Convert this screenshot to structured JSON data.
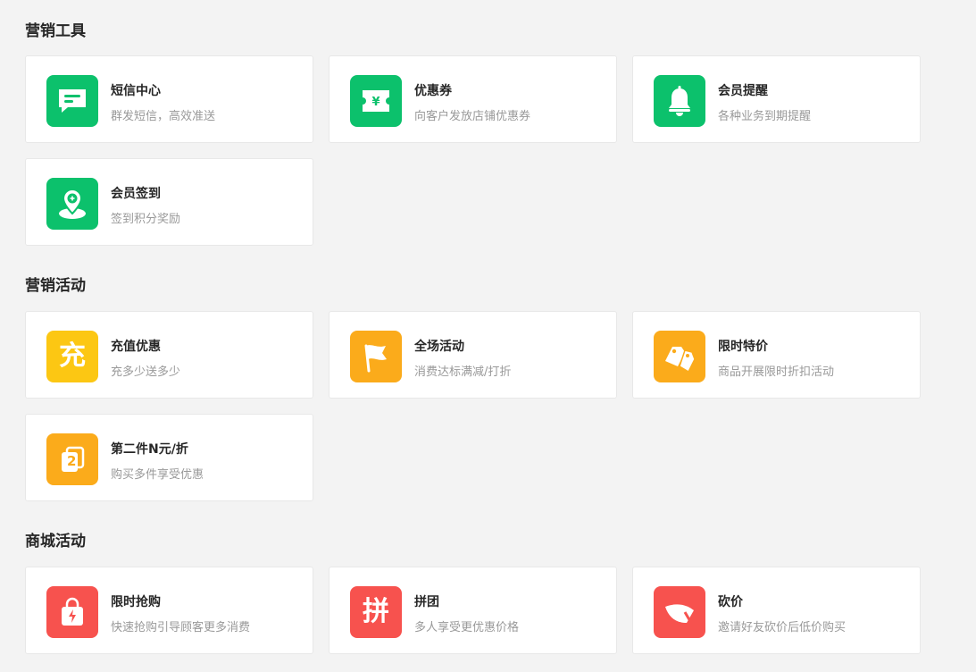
{
  "colors": {
    "green": "#0cc16c",
    "yellow": "#fcc713",
    "orange": "#fbab1b",
    "red": "#f7524e"
  },
  "sections": [
    {
      "title": "营销工具",
      "cards": [
        {
          "name": "短信中心",
          "desc": "群发短信，高效准送",
          "icon": "sms-icon"
        },
        {
          "name": "优惠券",
          "desc": "向客户发放店铺优惠券",
          "icon": "coupon-icon"
        },
        {
          "name": "会员提醒",
          "desc": "各种业务到期提醒",
          "icon": "bell-icon"
        },
        {
          "name": "会员签到",
          "desc": "签到积分奖励",
          "icon": "location-pin-icon"
        }
      ]
    },
    {
      "title": "营销活动",
      "cards": [
        {
          "name": "充值优惠",
          "desc": "充多少送多少",
          "icon": "recharge-icon",
          "icon_text": "充"
        },
        {
          "name": "全场活动",
          "desc": "消费达标满减/打折",
          "icon": "flag-icon"
        },
        {
          "name": "限时特价",
          "desc": "商品开展限时折扣活动",
          "icon": "price-tag-icon"
        },
        {
          "name": "第二件N元/折",
          "desc": "购买多件享受优惠",
          "icon": "second-item-icon",
          "icon_text": "2"
        }
      ]
    },
    {
      "title": "商城活动",
      "cards": [
        {
          "name": "限时抢购",
          "desc": "快速抢购引导顾客更多消费",
          "icon": "flash-sale-bag-icon"
        },
        {
          "name": "拼团",
          "desc": "多人享受更优惠价格",
          "icon": "group-buy-icon",
          "icon_text": "拼"
        },
        {
          "name": "砍价",
          "desc": "邀请好友砍价后低价购买",
          "icon": "bargain-knife-icon"
        }
      ]
    }
  ]
}
